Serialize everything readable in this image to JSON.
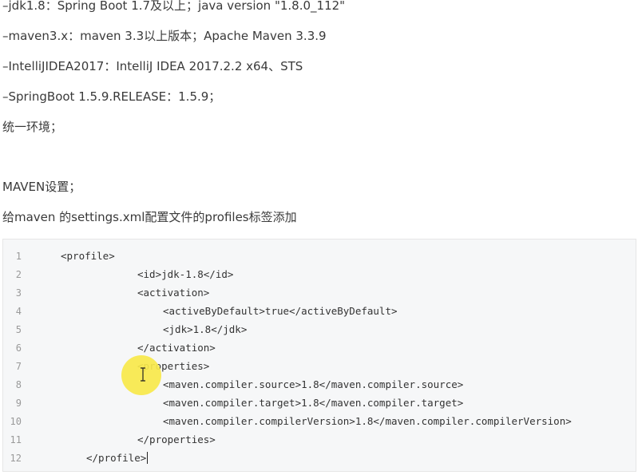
{
  "text_lines": [
    "–jdk1.8：Spring Boot 1.7及以上；java version \"1.8.0_112\"",
    "–maven3.x：maven 3.3以上版本；Apache Maven 3.3.9",
    "–IntelliJIDEA2017：IntelliJ IDEA 2017.2.2 x64、STS",
    "–SpringBoot 1.5.9.RELEASE：1.5.9；",
    "统一环境；",
    "MAVEN设置；",
    "给maven 的settings.xml配置文件的profiles标签添加"
  ],
  "code": {
    "line_numbers": [
      "1",
      "2",
      "3",
      "4",
      "5",
      "6",
      "7",
      "8",
      "9",
      "10",
      "11",
      "12"
    ],
    "lines": [
      "<profile>",
      "<id>jdk-1.8</id>",
      "<activation>",
      "<activeByDefault>true</activeByDefault>",
      "<jdk>1.8</jdk>",
      "</activation>",
      "<properties>",
      "<maven.compiler.source>1.8</maven.compiler.source>",
      "<maven.compiler.target>1.8</maven.compiler.target>",
      "<maven.compiler.compilerVersion>1.8</maven.compiler.compilerVersion>",
      "</properties>",
      "</profile>"
    ]
  },
  "colors": {
    "code_background": "#f6f7f8",
    "cursor_highlight": "#f7e84a",
    "line_number": "#9a9a9a"
  }
}
